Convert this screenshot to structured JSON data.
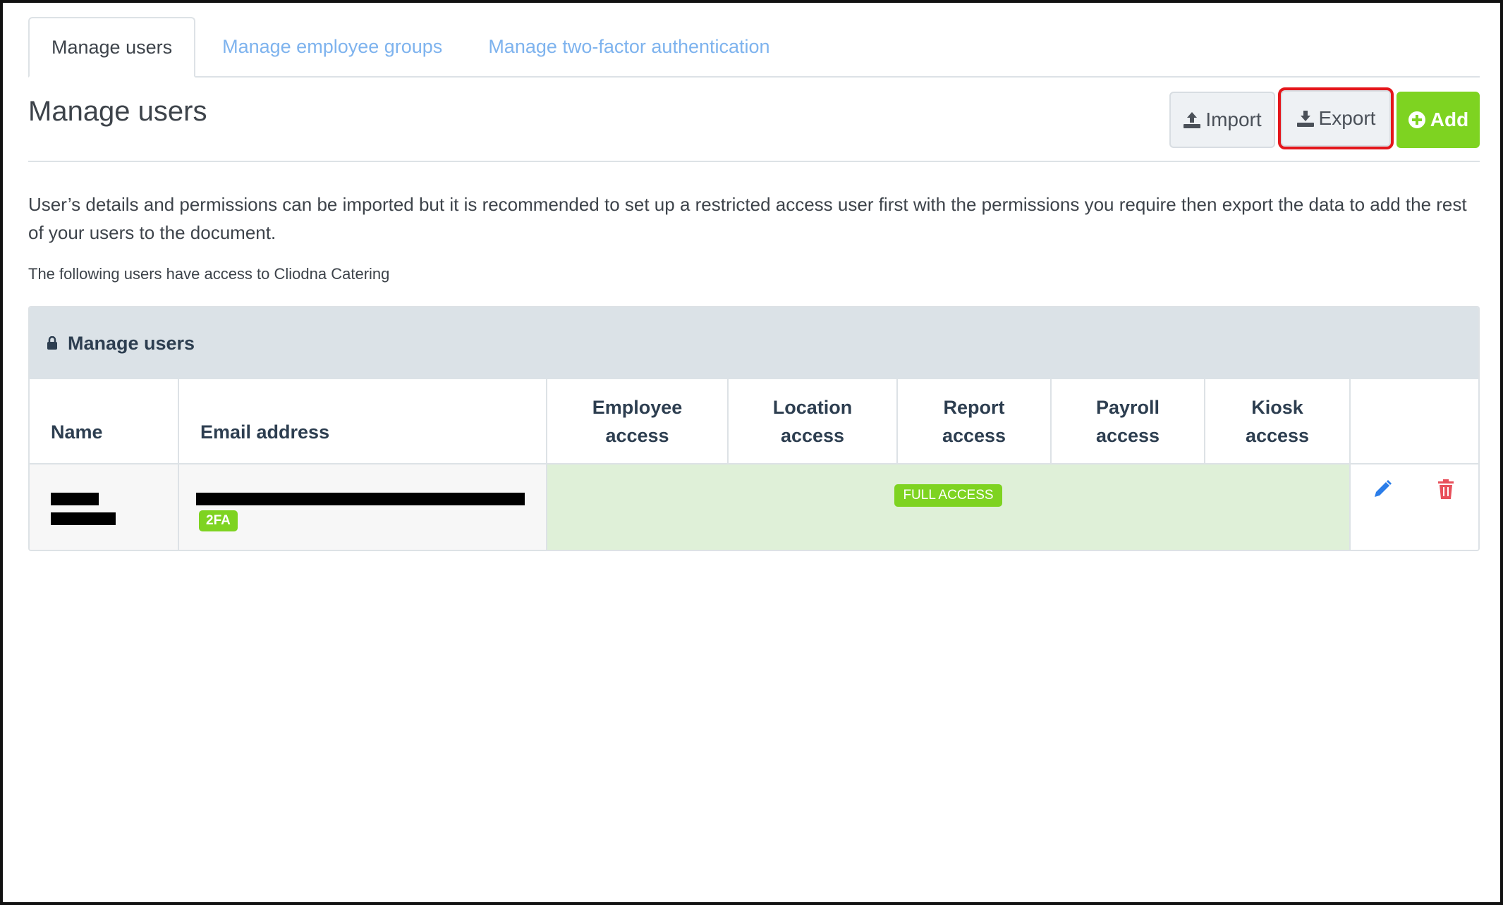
{
  "tabs": [
    {
      "label": "Manage users",
      "active": true
    },
    {
      "label": "Manage employee groups",
      "active": false
    },
    {
      "label": "Manage two-factor authentication",
      "active": false
    }
  ],
  "header": {
    "title": "Manage users",
    "import_label": "Import",
    "export_label": "Export",
    "add_label": "Add"
  },
  "description": "User’s details and permissions can be imported but it is recommended to set up a restricted access user first with the permissions you require then export the data to add the rest of your users to the document.",
  "access_note": "The following users have access to Cliodna Catering",
  "panel": {
    "title": "Manage users",
    "columns": {
      "name": "Name",
      "email": "Email address",
      "employee_1": "Employee",
      "employee_2": "access",
      "location_1": "Location",
      "location_2": "access",
      "report_1": "Report",
      "report_2": "access",
      "payroll_1": "Payroll",
      "payroll_2": "access",
      "kiosk_1": "Kiosk",
      "kiosk_2": "access"
    },
    "rows": [
      {
        "two_factor_badge": "2FA",
        "access_badge": "FULL ACCESS"
      }
    ]
  },
  "colors": {
    "accent_green": "#7ed321",
    "tab_link": "#7eb3ee",
    "highlight_red": "#e4161b",
    "edit_blue": "#2b7de9",
    "delete_red": "#e8505b"
  },
  "icons": [
    "upload-icon",
    "download-icon",
    "plus-circle-icon",
    "lock-icon",
    "pencil-icon",
    "trash-icon"
  ]
}
